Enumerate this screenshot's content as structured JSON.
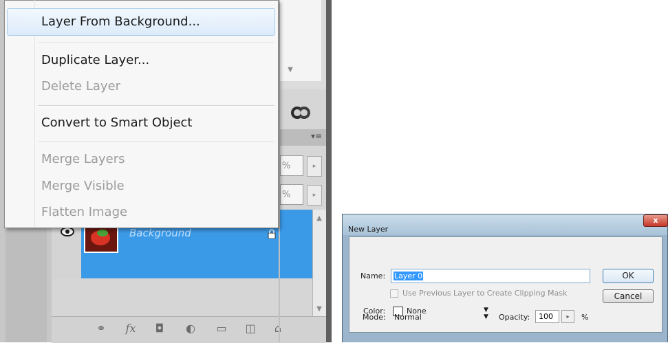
{
  "context_menu": {
    "items": [
      {
        "label": "Layer From Background...",
        "enabled": true,
        "highlighted": true
      },
      {
        "label": "Duplicate Layer...",
        "enabled": true
      },
      {
        "label": "Delete Layer",
        "enabled": false
      },
      {
        "label": "Convert to Smart Object",
        "enabled": true
      },
      {
        "label": "Merge Layers",
        "enabled": false
      },
      {
        "label": "Merge Visible",
        "enabled": false
      },
      {
        "label": "Flatten Image",
        "enabled": false
      }
    ]
  },
  "layers_panel": {
    "layer_name": "Background",
    "partial_values": [
      "%",
      "%"
    ],
    "bottom_icons": [
      "link-icon",
      "fx-icon",
      "mask-icon",
      "adjustment-icon",
      "folder-icon",
      "new-layer-icon",
      "trash-icon"
    ],
    "bottom_fx_label": "fx"
  },
  "new_layer_dialog": {
    "title": "New Layer",
    "close_label": "x",
    "name_label": "Name:",
    "name_value": "Layer 0",
    "clipping_label": "Use Previous Layer to Create Clipping Mask",
    "clipping_checked": false,
    "color_label": "Color:",
    "color_value": "None",
    "mode_label": "Mode:",
    "mode_value": "Normal",
    "opacity_label": "Opacity:",
    "opacity_value": "100",
    "opacity_unit": "%",
    "ok_label": "OK",
    "cancel_label": "Cancel"
  },
  "colors": {
    "selection_blue": "#3b9ae8",
    "menu_highlight": "#dcebfa",
    "dialog_frame": "#9bb6cc",
    "close_red": "#c6382a"
  }
}
